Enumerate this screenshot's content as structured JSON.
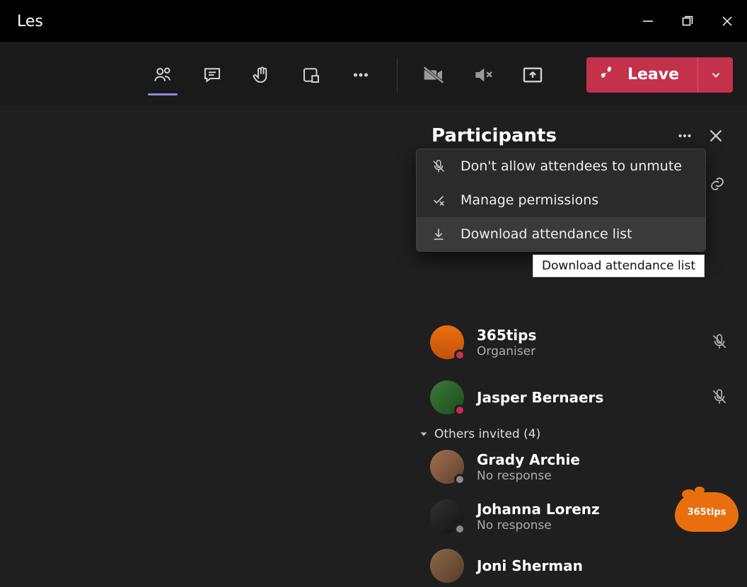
{
  "window": {
    "title": "Les"
  },
  "toolbar": {
    "leave_label": "Leave"
  },
  "panel": {
    "title": "Participants",
    "menu": {
      "item1": "Don't allow attendees to unmute",
      "item2": "Manage permissions",
      "item3": "Download attendance list"
    },
    "tooltip": "Download attendance list",
    "sections": {
      "others_invited_label": "Others invited (4)"
    },
    "participants": {
      "p1": {
        "name": "365tips",
        "role": "Organiser"
      },
      "p2": {
        "name": "Jasper Bernaers"
      },
      "p3": {
        "name": "Grady Archie",
        "status": "No response"
      },
      "p4": {
        "name": "Johanna Lorenz",
        "status": "No response"
      },
      "p5": {
        "name": "Joni Sherman"
      }
    }
  },
  "watermark": "365tips"
}
